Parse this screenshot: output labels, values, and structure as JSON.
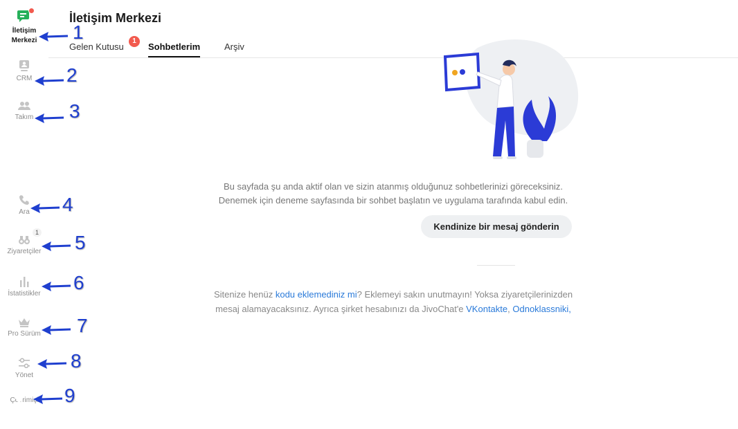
{
  "sidebar": {
    "items": [
      {
        "label_line1": "İletişim",
        "label_line2": "Merkezi",
        "icon": "chat-icon",
        "active": true,
        "has_notification_dot": true
      },
      {
        "label": "CRM",
        "icon": "crm-contact-icon"
      },
      {
        "label": "Takım",
        "icon": "team-icon"
      },
      {
        "label": "Ara",
        "icon": "phone-icon"
      },
      {
        "label": "Ziyaretçiler",
        "icon": "binoculars-icon",
        "count": "1"
      },
      {
        "label": "İstatistikler",
        "icon": "bar-chart-icon"
      },
      {
        "label": "Pro Sürüm",
        "icon": "crown-icon"
      },
      {
        "label": "Yönet",
        "icon": "sliders-icon"
      },
      {
        "label": "Çevrimiçi",
        "icon": "toggle-switch",
        "toggle_on": true
      }
    ]
  },
  "annotations": [
    "1",
    "2",
    "3",
    "4",
    "5",
    "6",
    "7",
    "8",
    "9"
  ],
  "header": {
    "title": "İletişim Merkezi",
    "tabs": [
      {
        "label": "Gelen Kutusu",
        "badge": "1"
      },
      {
        "label": "Sohbetlerim",
        "active": true
      },
      {
        "label": "Arşiv"
      }
    ]
  },
  "main": {
    "description_line1": "Bu sayfada şu anda aktif olan ve sizin atanmış olduğunuz sohbetlerinizi göreceksiniz.",
    "description_line2": "Denemek için deneme sayfasında bir sohbet başlatın ve uygulama tarafında kabul edin.",
    "cta_label": "Kendinize bir mesaj gönderin",
    "hint": {
      "part1": "Sitenize henüz ",
      "link1": "kodu eklemediniz mi",
      "part2": "? Eklemeyi sakın unutmayın! Yoksa ziyaretçilerinizden",
      "part3": "mesaj alamayacaksınız. Ayrıca şirket hesabınızı da JivoChat'e ",
      "link2": "VKontakte",
      "sep": ", ",
      "link3": "Odnoklassniki,"
    }
  },
  "colors": {
    "accent_green": "#26b05a",
    "notification_red": "#f25a4e",
    "link_blue": "#2a7ad9",
    "annotation_blue": "#1f3fcf"
  }
}
